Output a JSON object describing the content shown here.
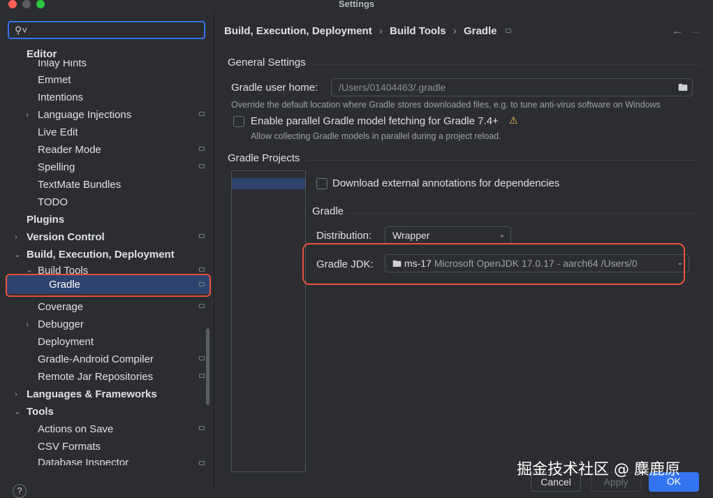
{
  "window": {
    "title": "Settings"
  },
  "search": {
    "placeholder": ""
  },
  "sidebar": {
    "items": [
      {
        "label": "Editor"
      },
      {
        "label": "Inlay Hints"
      },
      {
        "label": "Emmet"
      },
      {
        "label": "Intentions"
      },
      {
        "label": "Language Injections"
      },
      {
        "label": "Live Edit"
      },
      {
        "label": "Reader Mode"
      },
      {
        "label": "Spelling"
      },
      {
        "label": "TextMate Bundles"
      },
      {
        "label": "TODO"
      },
      {
        "label": "Plugins"
      },
      {
        "label": "Version Control"
      },
      {
        "label": "Build, Execution, Deployment"
      },
      {
        "label": "Build Tools"
      },
      {
        "label": "Gradle"
      },
      {
        "label": "Coverage"
      },
      {
        "label": "Debugger"
      },
      {
        "label": "Deployment"
      },
      {
        "label": "Gradle-Android Compiler"
      },
      {
        "label": "Remote Jar Repositories"
      },
      {
        "label": "Languages & Frameworks"
      },
      {
        "label": "Tools"
      },
      {
        "label": "Actions on Save"
      },
      {
        "label": "CSV Formats"
      },
      {
        "label": "Database Inspector"
      }
    ],
    "help": "?"
  },
  "breadcrumb": {
    "items": [
      "Build, Execution, Deployment",
      "Build Tools",
      "Gradle"
    ],
    "separator": "›"
  },
  "general": {
    "title": "General Settings",
    "gradle_home_label": "Gradle user home:",
    "gradle_home_value": "/Users/01404463/.gradle",
    "gradle_home_hint": "Override the default location where Gradle stores downloaded files, e.g. to tune anti-virus software on Windows",
    "parallel_label": "Enable parallel Gradle model fetching for Gradle 7.4+",
    "parallel_hint": "Allow collecting Gradle models in parallel during a project reload."
  },
  "projects": {
    "title": "Gradle Projects",
    "download_annotations_label": "Download external annotations for dependencies",
    "gradle_section": "Gradle",
    "distribution_label": "Distribution:",
    "distribution_value": "Wrapper",
    "jdk_label": "Gradle JDK:",
    "jdk_name": "ms-17",
    "jdk_detail": "Microsoft OpenJDK 17.0.17 - aarch64 /Users/0"
  },
  "buttons": {
    "cancel": "Cancel",
    "apply": "Apply",
    "ok": "OK"
  },
  "watermark": "掘金技术社区 @ 麋鹿原",
  "colors": {
    "accent": "#3574f0",
    "highlight": "#e5533c",
    "selection": "#2e436e",
    "warning": "#f2c55c"
  }
}
